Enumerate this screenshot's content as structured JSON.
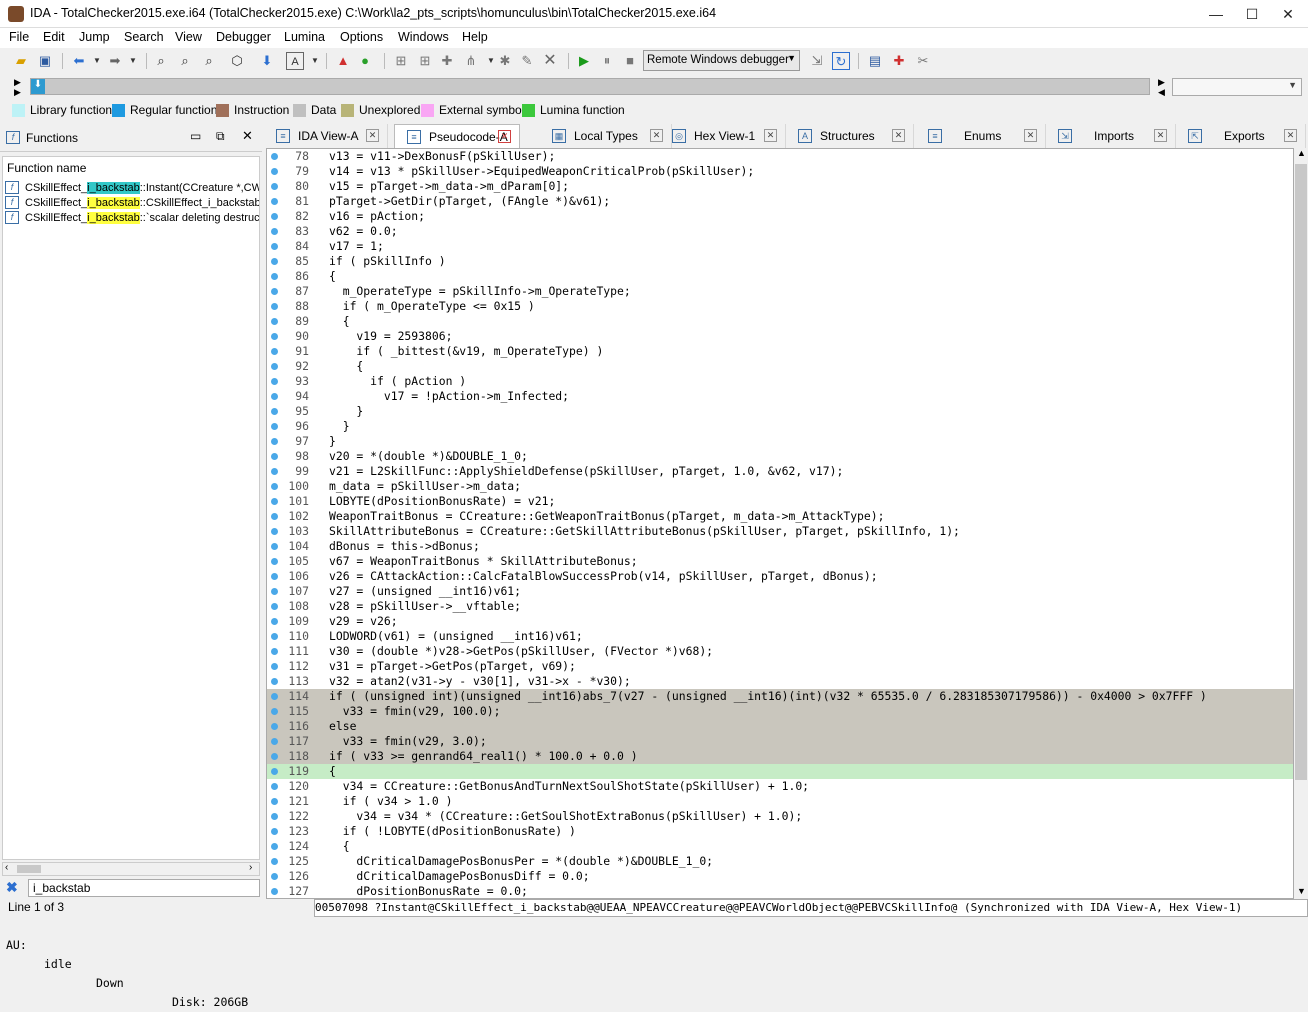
{
  "title": "IDA - TotalChecker2015.exe.i64 (TotalChecker2015.exe) C:\\Work\\la2_pts_scripts\\homunculus\\bin\\TotalChecker2015.exe.i64",
  "window_controls": {
    "minimize": "—",
    "maximize": "☐",
    "close": "✕"
  },
  "menu": [
    "File",
    "Edit",
    "Jump",
    "Search",
    "View",
    "Debugger",
    "Lumina",
    "Options",
    "Windows",
    "Help"
  ],
  "debugger_select": "Remote Windows debugger",
  "legend": [
    {
      "label": "Library function",
      "color": "#bdf2f6"
    },
    {
      "label": "Regular function",
      "color": "#1e9ae0"
    },
    {
      "label": "Instruction",
      "color": "#a0705a"
    },
    {
      "label": "Data",
      "color": "#c0c0c0"
    },
    {
      "label": "Unexplored",
      "color": "#b8b478"
    },
    {
      "label": "External symbol",
      "color": "#f9a6f4"
    },
    {
      "label": "Lumina function",
      "color": "#3cc83c"
    }
  ],
  "tabs": [
    {
      "label": "IDA View-A",
      "icon": "disassembly-icon"
    },
    {
      "label": "Pseudocode-A",
      "icon": "pseudocode-icon"
    },
    {
      "label": "Local Types",
      "icon": "local-types-icon"
    },
    {
      "label": "Hex View-1",
      "icon": "hex-view-icon"
    },
    {
      "label": "Structures",
      "icon": "structures-icon"
    },
    {
      "label": "Enums",
      "icon": "enums-icon"
    },
    {
      "label": "Imports",
      "icon": "imports-icon"
    },
    {
      "label": "Exports",
      "icon": "exports-icon"
    }
  ],
  "functions_panel": {
    "title": "Functions",
    "column": "Function name",
    "items": [
      {
        "pre": "CSkillEffect_",
        "hl": "i_backstab",
        "post": "::Instant(CCreature *,CW"
      },
      {
        "pre": "CSkillEffect_",
        "hl": "i_backstab",
        "post": "::CSkillEffect_i_backstab("
      },
      {
        "pre": "CSkillEffect_",
        "hl": "i_backstab",
        "post": "::`scalar deleting destruc"
      }
    ],
    "search_value": "i_backstab",
    "line_info": "Line 1 of 3"
  },
  "code_lines": [
    {
      "n": "78",
      "t": "v13 = v11->DexBonusF(pSkillUser);"
    },
    {
      "n": "79",
      "t": "v14 = v13 * pSkillUser->EquipedWeaponCriticalProb(pSkillUser);"
    },
    {
      "n": "80",
      "t": "v15 = pTarget->m_data->m_dParam[0];"
    },
    {
      "n": "81",
      "t": "pTarget->GetDir(pTarget, (FAngle *)&v61);"
    },
    {
      "n": "82",
      "t": "v16 = pAction;"
    },
    {
      "n": "83",
      "t": "v62 = 0.0;"
    },
    {
      "n": "84",
      "t": "v17 = 1;"
    },
    {
      "n": "85",
      "t": "if ( pSkillInfo )"
    },
    {
      "n": "86",
      "t": "{"
    },
    {
      "n": "87",
      "t": "  m_OperateType = pSkillInfo->m_OperateType;"
    },
    {
      "n": "88",
      "t": "  if ( m_OperateType <= 0x15 )"
    },
    {
      "n": "89",
      "t": "  {"
    },
    {
      "n": "90",
      "t": "    v19 = 2593806;"
    },
    {
      "n": "91",
      "t": "    if ( _bittest(&v19, m_OperateType) )"
    },
    {
      "n": "92",
      "t": "    {"
    },
    {
      "n": "93",
      "t": "      if ( pAction )"
    },
    {
      "n": "94",
      "t": "        v17 = !pAction->m_Infected;"
    },
    {
      "n": "95",
      "t": "    }"
    },
    {
      "n": "96",
      "t": "  }"
    },
    {
      "n": "97",
      "t": "}"
    },
    {
      "n": "98",
      "t": "v20 = *(double *)&DOUBLE_1_0;"
    },
    {
      "n": "99",
      "t": "v21 = L2SkillFunc::ApplyShieldDefense(pSkillUser, pTarget, 1.0, &v62, v17);"
    },
    {
      "n": "100",
      "t": "m_data = pSkillUser->m_data;"
    },
    {
      "n": "101",
      "t": "LOBYTE(dPositionBonusRate) = v21;"
    },
    {
      "n": "102",
      "t": "WeaponTraitBonus = CCreature::GetWeaponTraitBonus(pTarget, m_data->m_AttackType);"
    },
    {
      "n": "103",
      "t": "SkillAttributeBonus = CCreature::GetSkillAttributeBonus(pSkillUser, pTarget, pSkillInfo, 1);"
    },
    {
      "n": "104",
      "t": "dBonus = this->dBonus;"
    },
    {
      "n": "105",
      "t": "v67 = WeaponTraitBonus * SkillAttributeBonus;"
    },
    {
      "n": "106",
      "t": "v26 = CAttackAction::CalcFatalBlowSuccessProb(v14, pSkillUser, pTarget, dBonus);"
    },
    {
      "n": "107",
      "t": "v27 = (unsigned __int16)v61;"
    },
    {
      "n": "108",
      "t": "v28 = pSkillUser->__vftable;"
    },
    {
      "n": "109",
      "t": "v29 = v26;"
    },
    {
      "n": "110",
      "t": "LODWORD(v61) = (unsigned __int16)v61;"
    },
    {
      "n": "111",
      "t": "v30 = (double *)v28->GetPos(pSkillUser, (FVector *)v68);"
    },
    {
      "n": "112",
      "t": "v31 = pTarget->GetPos(pTarget, v69);"
    },
    {
      "n": "113",
      "t": "v32 = atan2(v31->y - v30[1], v31->x - *v30);"
    },
    {
      "n": "114",
      "t": "if ( (unsigned int)(unsigned __int16)abs_7(v27 - (unsigned __int16)(int)(v32 * 65535.0 / 6.283185307179586)) - 0x4000 > 0x7FFF )"
    },
    {
      "n": "115",
      "t": "  v33 = fmin(v29, 100.0);"
    },
    {
      "n": "116",
      "t": "else"
    },
    {
      "n": "117",
      "t": "  v33 = fmin(v29, 3.0);"
    },
    {
      "n": "118",
      "t": "if ( v33 >= genrand64_real1() * 100.0 + 0.0 )"
    },
    {
      "n": "119",
      "t": "{"
    },
    {
      "n": "120",
      "t": "  v34 = CCreature::GetBonusAndTurnNextSoulShotState(pSkillUser) + 1.0;"
    },
    {
      "n": "121",
      "t": "  if ( v34 > 1.0 )"
    },
    {
      "n": "122",
      "t": "    v34 = v34 * (CCreature::GetSoulShotExtraBonus(pSkillUser) + 1.0);"
    },
    {
      "n": "123",
      "t": "  if ( !LOBYTE(dPositionBonusRate) )"
    },
    {
      "n": "124",
      "t": "  {"
    },
    {
      "n": "125",
      "t": "    dCriticalDamagePosBonusPer = *(double *)&DOUBLE_1_0;"
    },
    {
      "n": "126",
      "t": "    dCriticalDamagePosBonusDiff = 0.0;"
    },
    {
      "n": "127",
      "t": "    dPositionBonusRate = 0.0;"
    }
  ],
  "address_bar": "00507098 ?Instant@CSkillEffect_i_backstab@@UEAA_NPEAVCCreature@@PEAVCWorldObject@@PEBVCSkillInfo@ (Synchronized with IDA View-A, Hex View-1)",
  "status": {
    "au": "AU:",
    "state": "idle",
    "direction": "Down",
    "disk": "Disk: 206GB"
  }
}
